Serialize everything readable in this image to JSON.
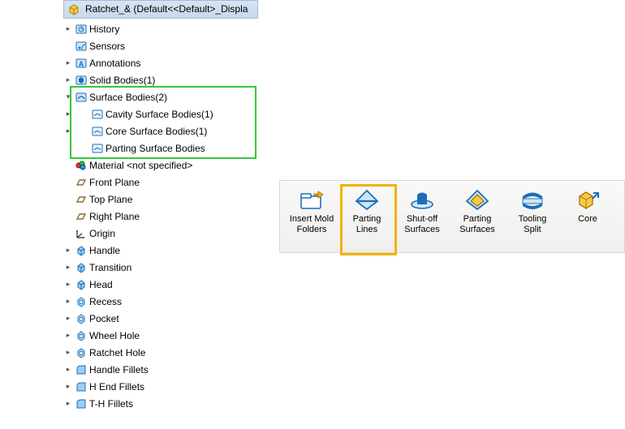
{
  "header": {
    "title": "Ratchet_&  (Default<<Default>_Displa"
  },
  "tree": {
    "items": [
      {
        "depth": 0,
        "expander": "▸",
        "icon": "history-icon",
        "label": "History"
      },
      {
        "depth": 0,
        "expander": "",
        "icon": "sensors-icon",
        "label": "Sensors"
      },
      {
        "depth": 0,
        "expander": "▸",
        "icon": "annotations-icon",
        "label": "Annotations"
      },
      {
        "depth": 0,
        "expander": "▸",
        "icon": "solid-bodies-icon",
        "label": "Solid Bodies(1)"
      },
      {
        "depth": 0,
        "expander": "▾",
        "icon": "surface-bodies-icon",
        "label": "Surface Bodies(2)"
      },
      {
        "depth": 1,
        "expander": "▸",
        "icon": "surface-body-sub-icon",
        "label": "Cavity Surface Bodies(1)"
      },
      {
        "depth": 1,
        "expander": "▸",
        "icon": "surface-body-sub-icon",
        "label": "Core Surface Bodies(1)"
      },
      {
        "depth": 1,
        "expander": "",
        "icon": "surface-body-sub-icon",
        "label": "Parting Surface Bodies"
      },
      {
        "depth": 0,
        "expander": "",
        "icon": "material-icon",
        "label": "Material <not specified>"
      },
      {
        "depth": 0,
        "expander": "",
        "icon": "plane-icon",
        "label": "Front Plane"
      },
      {
        "depth": 0,
        "expander": "",
        "icon": "plane-icon",
        "label": "Top Plane"
      },
      {
        "depth": 0,
        "expander": "",
        "icon": "plane-icon",
        "label": "Right Plane"
      },
      {
        "depth": 0,
        "expander": "",
        "icon": "origin-icon",
        "label": "Origin"
      },
      {
        "depth": 0,
        "expander": "▸",
        "icon": "feature-icon",
        "label": "Handle"
      },
      {
        "depth": 0,
        "expander": "▸",
        "icon": "feature-icon",
        "label": "Transition"
      },
      {
        "depth": 0,
        "expander": "▸",
        "icon": "feature-icon",
        "label": "Head"
      },
      {
        "depth": 0,
        "expander": "▸",
        "icon": "cut-feature-icon",
        "label": "Recess"
      },
      {
        "depth": 0,
        "expander": "▸",
        "icon": "cut-feature-icon",
        "label": "Pocket"
      },
      {
        "depth": 0,
        "expander": "▸",
        "icon": "cut-feature-icon",
        "label": "Wheel Hole"
      },
      {
        "depth": 0,
        "expander": "▸",
        "icon": "cut-feature-icon",
        "label": "Ratchet Hole"
      },
      {
        "depth": 0,
        "expander": "▸",
        "icon": "fillet-icon",
        "label": "Handle Fillets"
      },
      {
        "depth": 0,
        "expander": "▸",
        "icon": "fillet-icon",
        "label": "H End Fillets"
      },
      {
        "depth": 0,
        "expander": "▸",
        "icon": "fillet-icon",
        "label": "T-H Fillets"
      }
    ],
    "highlight": {
      "startIndex": 4,
      "endIndex": 7
    }
  },
  "toolbar": {
    "items": [
      {
        "icon": "insert-mold-folders-icon",
        "label": "Insert Mold Folders"
      },
      {
        "icon": "parting-lines-icon",
        "label": "Parting Lines"
      },
      {
        "icon": "shutoff-surfaces-icon",
        "label": "Shut-off Surfaces"
      },
      {
        "icon": "parting-surfaces-icon",
        "label": "Parting Surfaces"
      },
      {
        "icon": "tooling-split-icon",
        "label": "Tooling Split"
      },
      {
        "icon": "core-icon",
        "label": "Core"
      }
    ],
    "highlightIndex": 1
  }
}
